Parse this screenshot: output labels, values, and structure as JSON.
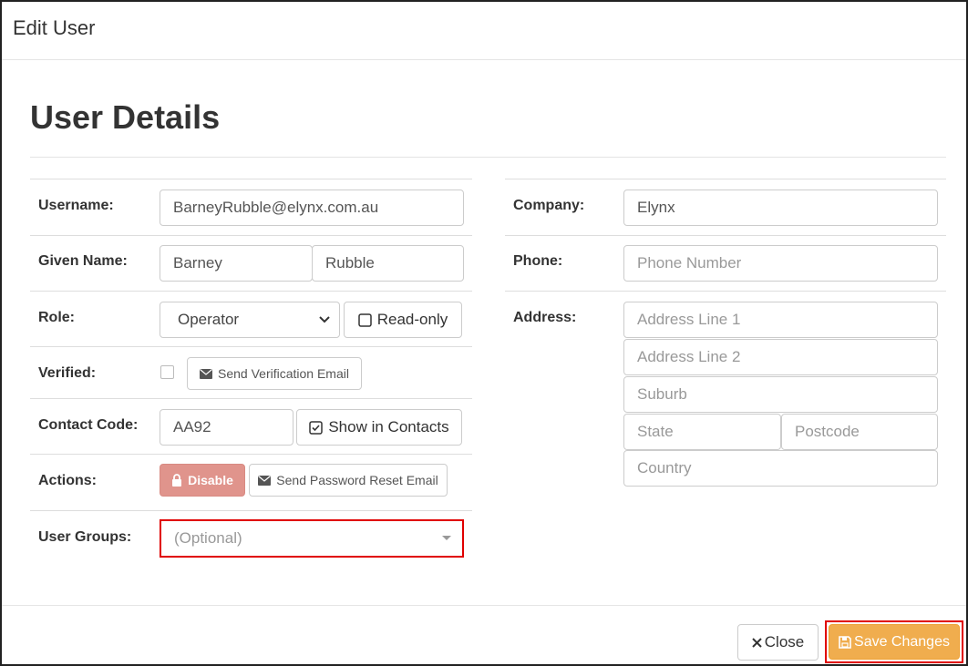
{
  "modal": {
    "title": "Edit User"
  },
  "section": {
    "title": "User Details"
  },
  "labels": {
    "username": "Username:",
    "given_name": "Given Name:",
    "role": "Role:",
    "verified": "Verified:",
    "contact_code": "Contact Code:",
    "actions": "Actions:",
    "user_groups": "User Groups:",
    "company": "Company:",
    "phone": "Phone:",
    "address": "Address:"
  },
  "fields": {
    "username": "BarneyRubble@elynx.com.au",
    "given_name": "Barney",
    "family_name": "Rubble",
    "role_selected": "Operator",
    "contact_code": "AA92",
    "company": "Elynx",
    "user_groups_placeholder": "(Optional)",
    "phone_placeholder": "Phone Number",
    "address_line1_placeholder": "Address Line 1",
    "address_line2_placeholder": "Address Line 2",
    "suburb_placeholder": "Suburb",
    "state_placeholder": "State",
    "postcode_placeholder": "Postcode",
    "country_placeholder": "Country"
  },
  "buttons": {
    "read_only": "Read-only",
    "send_verification": "Send Verification Email",
    "show_in_contacts": "Show in Contacts",
    "disable": "Disable",
    "send_password_reset": "Send Password Reset Email",
    "close": "Close",
    "save_changes": "Save Changes"
  },
  "colors": {
    "disable_bg": "#e0948c",
    "save_bg": "#f0ad4e",
    "highlight": "#e00000"
  },
  "icons": {
    "role_dropdown": "chevron-down-icon",
    "read_only": "checkbox-empty-icon",
    "send_verification": "envelope-icon",
    "show_in_contacts": "checkbox-checked-icon",
    "disable": "lock-icon",
    "send_password_reset": "envelope-icon",
    "user_groups_dropdown": "caret-down-icon",
    "close": "close-icon",
    "save_changes": "save-icon"
  }
}
